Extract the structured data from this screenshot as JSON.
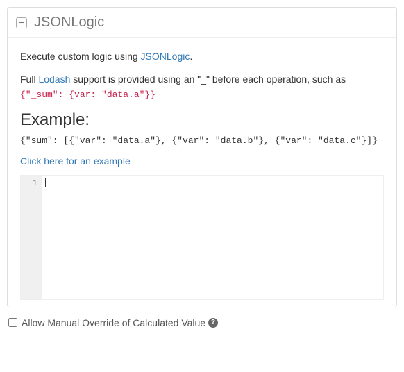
{
  "panel": {
    "title": "JSONLogic",
    "collapse_glyph": "−"
  },
  "desc": {
    "line1_prefix": "Execute custom logic using ",
    "line1_link": "JSONLogic",
    "line1_suffix": ".",
    "line2_prefix": "Full ",
    "line2_link": "Lodash",
    "line2_mid": " support is provided using an \"_\" before each operation, such as ",
    "line2_code": "{\"_sum\": {var: \"data.a\"}}"
  },
  "example": {
    "heading": "Example:",
    "code": "{\"sum\": [{\"var\": \"data.a\"}, {\"var\": \"data.b\"}, {\"var\": \"data.c\"}]}",
    "link_text": "Click here for an example"
  },
  "editor": {
    "line_number": "1",
    "content": ""
  },
  "override": {
    "label": "Allow Manual Override of Calculated Value",
    "help_glyph": "?"
  }
}
